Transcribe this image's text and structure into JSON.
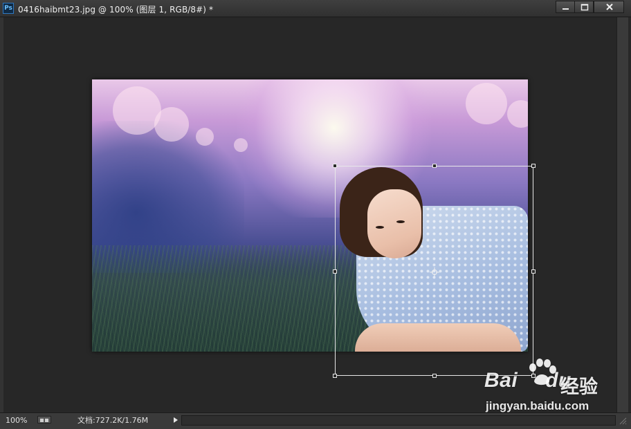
{
  "window": {
    "app_icon": "Ps",
    "title": "0416haibmt23.jpg @ 100% (图层 1, RGB/8#) *",
    "controls": {
      "minimize": "minimize-icon",
      "maximize": "maximize-icon",
      "close": "close-icon"
    }
  },
  "canvas": {
    "tool_state": "free-transform",
    "reference_point_icon": "crosshair-icon"
  },
  "statusbar": {
    "zoom": "100%",
    "doc_info": "文档:727.2K/1.76M"
  },
  "watermark": {
    "logo": "Bai",
    "logo_suffix": "du",
    "logo_cn": "经验",
    "url": "jingyan.baidu.com"
  },
  "colors": {
    "workspace": "#282828",
    "titlebar": "#353535",
    "transform_box": "#e8e8e8"
  }
}
